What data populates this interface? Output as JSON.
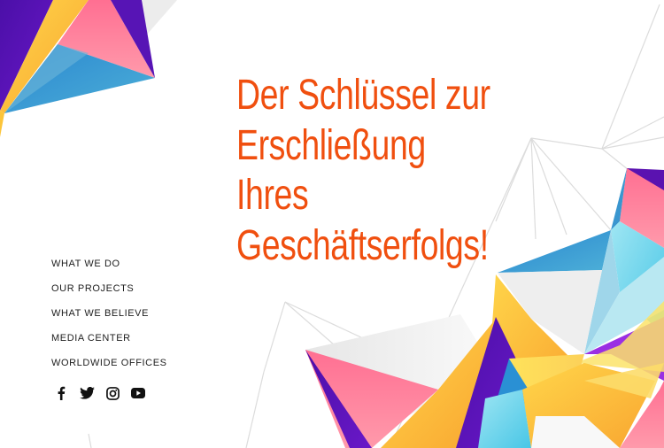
{
  "hero": {
    "headline_lines": [
      "Der Schlüssel zur",
      "Erschließung",
      "Ihres",
      "Geschäftserfolgs!"
    ],
    "accent_color": "#f04f0f"
  },
  "nav": {
    "items": [
      {
        "label": "WHAT WE DO"
      },
      {
        "label": "OUR PROJECTS"
      },
      {
        "label": "WHAT WE BELIEVE"
      },
      {
        "label": "MEDIA CENTER"
      },
      {
        "label": "WORLDWIDE OFFICES"
      }
    ]
  },
  "social": {
    "icons": [
      "facebook-icon",
      "twitter-icon",
      "instagram-icon",
      "youtube-icon"
    ]
  },
  "palette": {
    "purple": "#5a12b0",
    "pink": "#ff7f9c",
    "yellow": "#fcc53a",
    "blue": "#2e90d0",
    "cyan": "#7fdcef",
    "grey_line": "#d9d9d9"
  }
}
